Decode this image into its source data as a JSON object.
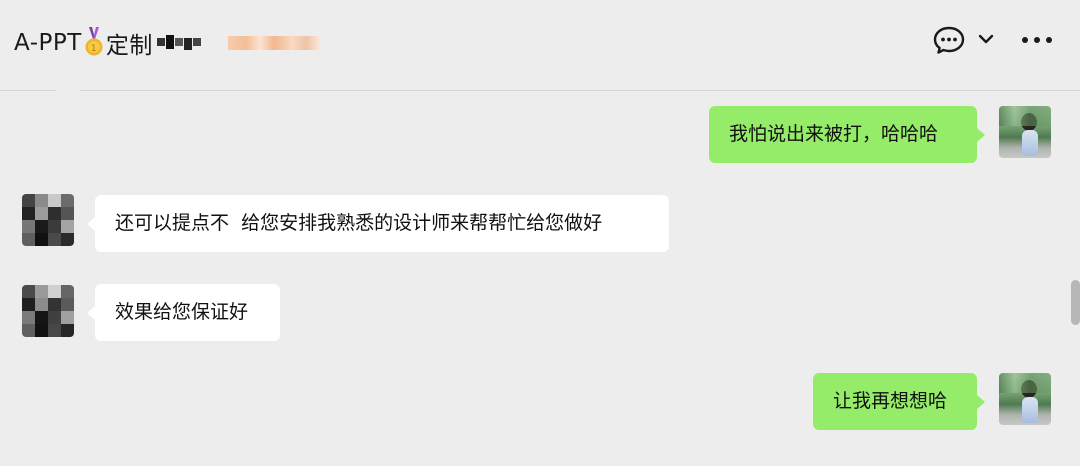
{
  "header": {
    "title_prefix": "A-PPT",
    "title_suffix": "定制",
    "icons": [
      "medal-icon",
      "chat-bubble-icon",
      "chevron-down-icon",
      "more-icon"
    ]
  },
  "colors": {
    "background": "#ededed",
    "sent_bubble": "#95ec69",
    "received_bubble": "#ffffff"
  },
  "messages": [
    {
      "direction": "sent",
      "text": "我怕说出来被打，哈哈哈"
    },
    {
      "direction": "received",
      "text": "还可以提点不  给您安排我熟悉的设计师来帮帮忙给您做好"
    },
    {
      "direction": "received",
      "text": "效果给您保证好"
    },
    {
      "direction": "sent",
      "text": "让我再想想哈"
    }
  ]
}
